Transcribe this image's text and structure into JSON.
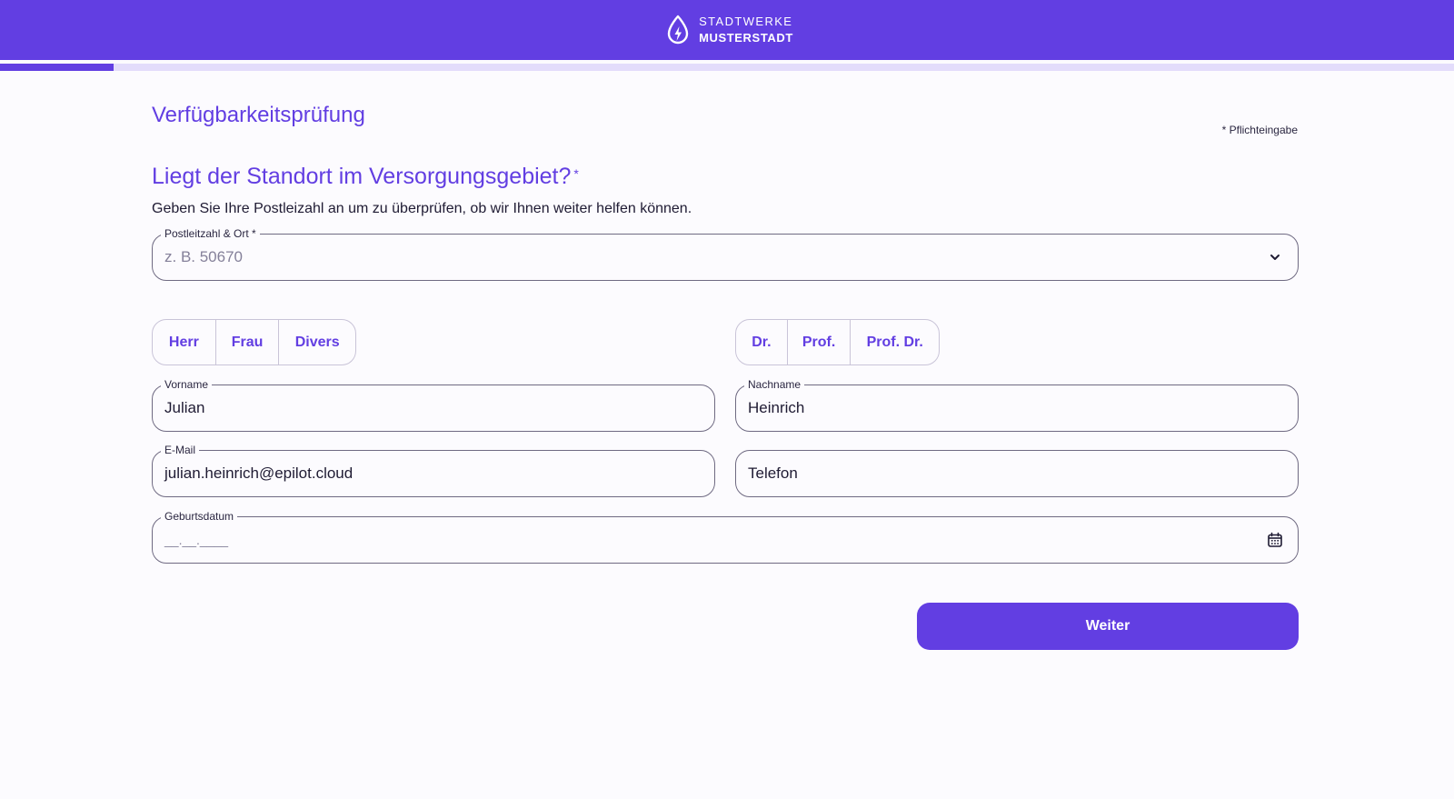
{
  "header": {
    "brand_line1": "STADTWERKE",
    "brand_line2": "MUSTERSTADT",
    "logo_icon": "water-drop-lightning-icon",
    "bg_color": "#623ee2"
  },
  "progress": {
    "fraction": 0.078
  },
  "page": {
    "title": "Verfügbarkeitsprüfung",
    "required_note": "* Pflichteingabe"
  },
  "question": {
    "title": "Liegt der Standort im Versorgungsgebiet?",
    "asterisk": "*",
    "description": "Geben Sie Ihre Postleizahl an um zu überprüfen, ob wir Ihnen weiter helfen können."
  },
  "postal_field": {
    "label": "Postleitzahl & Ort *",
    "placeholder": "z. B. 50670",
    "icon": "chevron-down-icon"
  },
  "salutation": {
    "options": [
      "Herr",
      "Frau",
      "Divers"
    ]
  },
  "title_options": {
    "options": [
      "Dr.",
      "Prof.",
      "Prof. Dr."
    ]
  },
  "first_name": {
    "label": "Vorname",
    "value": "Julian"
  },
  "last_name": {
    "label": "Nachname",
    "value": "Heinrich"
  },
  "email": {
    "label": "E-Mail",
    "value": "julian.heinrich@epilot.cloud"
  },
  "phone": {
    "placeholder": "Telefon"
  },
  "birthdate": {
    "label": "Geburtsdatum",
    "mask": "__.__.____",
    "icon": "calendar-icon"
  },
  "actions": {
    "next_label": "Weiter"
  },
  "colors": {
    "accent": "#623ee2",
    "text": "#1f1b33",
    "border": "#6f6a82"
  }
}
